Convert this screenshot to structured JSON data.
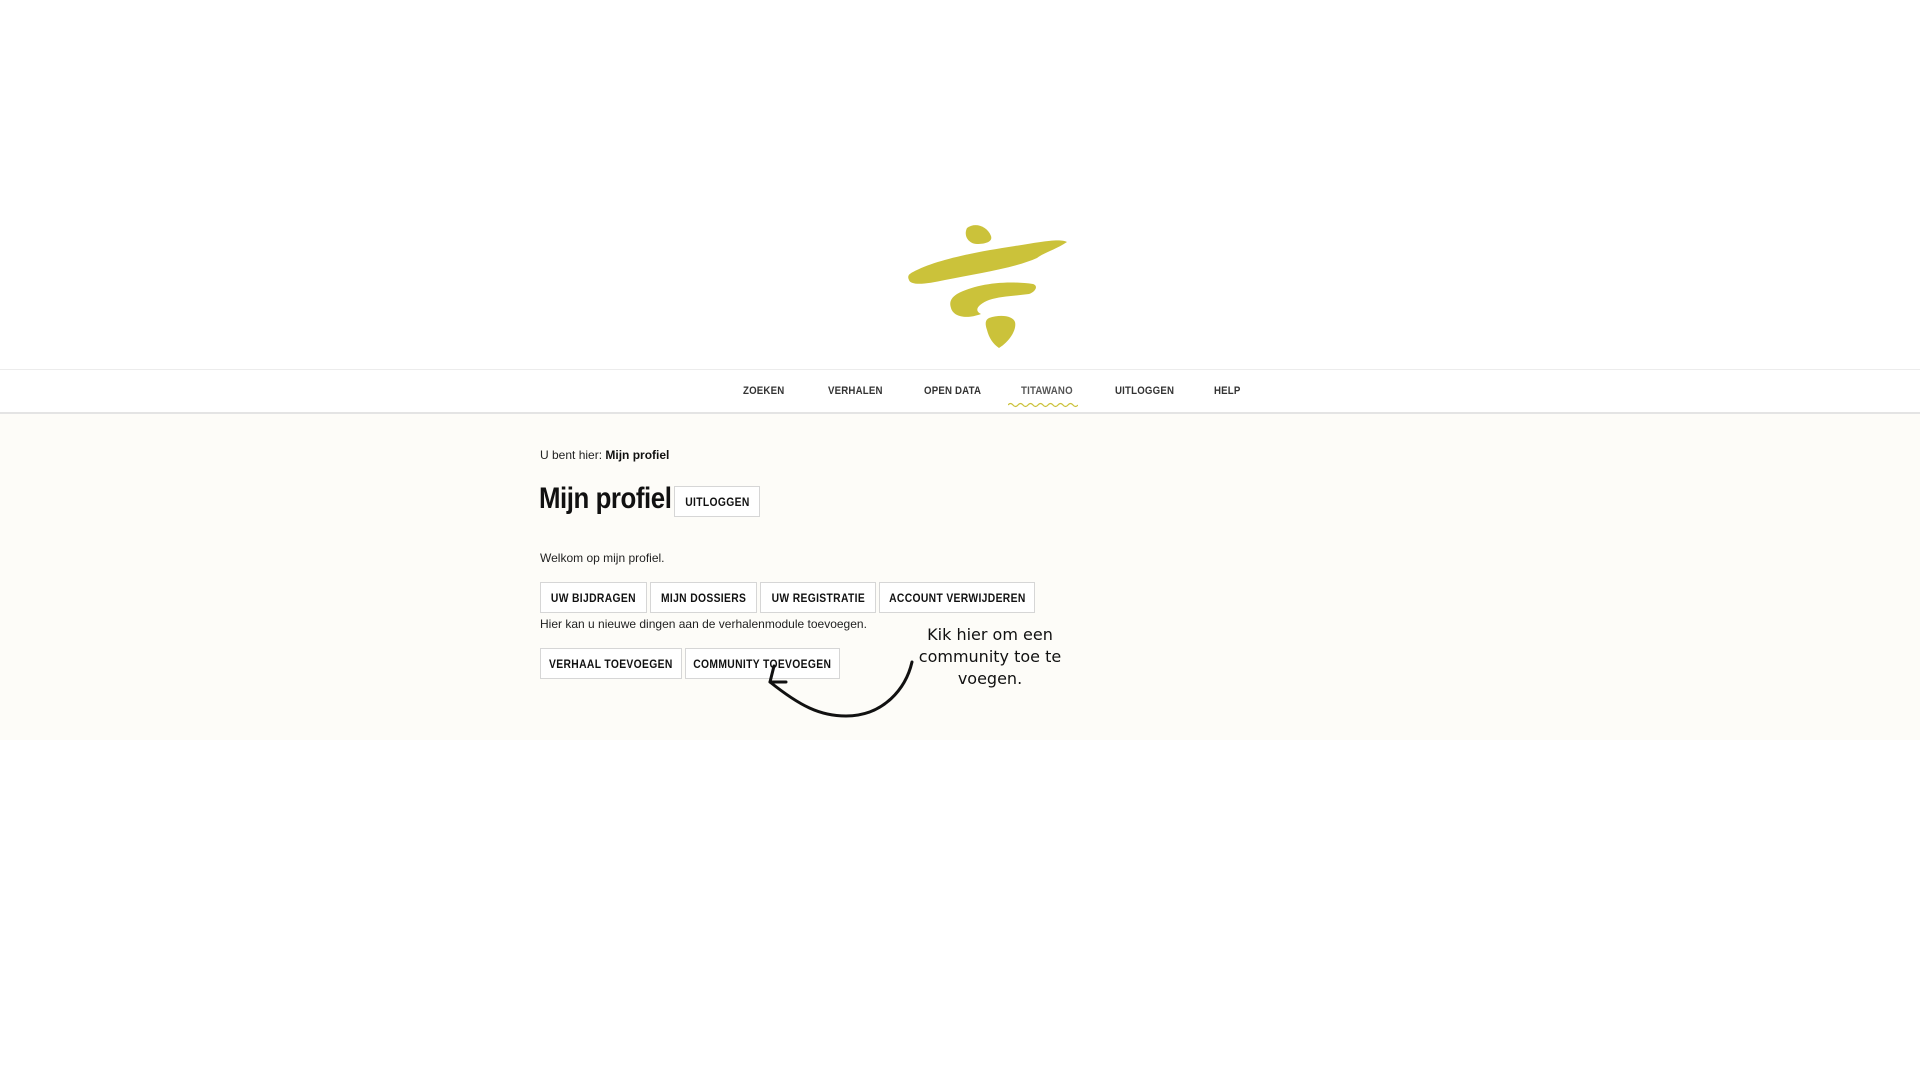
{
  "brand": {
    "logo_icon": "stacked-brush-strokes-logo",
    "accent_color": "#cbc23a"
  },
  "nav": {
    "items": [
      {
        "label": "ZOEKEN"
      },
      {
        "label": "VERHALEN"
      },
      {
        "label": "OPEN DATA"
      },
      {
        "label": "TITAWANO",
        "active": true
      },
      {
        "label": "UITLOGGEN"
      },
      {
        "label": "HELP"
      }
    ]
  },
  "breadcrumb": {
    "prefix": "U bent hier:",
    "current": "Mijn profiel"
  },
  "page": {
    "title": "Mijn profiel",
    "logout_label": "UITLOGGEN"
  },
  "welcome_text": "Welkom op mijn profiel.",
  "profile_tabs": [
    {
      "label": "UW BIJDRAGEN"
    },
    {
      "label": "MIJN DOSSIERS"
    },
    {
      "label": "UW REGISTRATIE"
    },
    {
      "label": "ACCOUNT VERWIJDEREN"
    }
  ],
  "add_hint": "Hier kan u nieuwe dingen aan de verhalenmodule toevoegen.",
  "add_buttons": [
    {
      "label": "VERHAAL TOEVOEGEN"
    },
    {
      "label": "COMMUNITY TOEVOEGEN"
    }
  ],
  "annotation": {
    "text": "Kik hier om een community toe te voegen.",
    "icon": "curved-arrow-icon"
  }
}
